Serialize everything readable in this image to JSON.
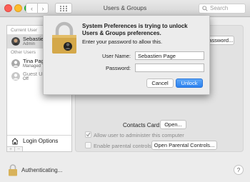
{
  "window": {
    "title": "Users & Groups",
    "search_placeholder": "Search"
  },
  "sidebar": {
    "current_user_label": "Current User",
    "current_user": {
      "name": "Sebastien Page",
      "role": "Admin"
    },
    "other_users_label": "Other Users",
    "other_users": [
      {
        "name": "Tina Page",
        "role": "Managed"
      },
      {
        "name": "Guest User",
        "role": "Off"
      }
    ],
    "login_options_label": "Login Options",
    "add_symbol": "+",
    "remove_symbol": "−"
  },
  "main": {
    "password_button_label": "…assword...",
    "contacts_card_label": "Contacts Card:",
    "open_button_label": "Open...",
    "allow_admin_label": "Allow user to administer this computer",
    "parental_controls_label": "Enable parental controls",
    "open_parental_button_label": "Open Parental Controls..."
  },
  "footer": {
    "authenticating_label": "Authenticating...",
    "help_symbol": "?"
  },
  "dialog": {
    "title": "System Preferences is trying to unlock Users & Groups preferences.",
    "message": "Enter your password to allow this.",
    "username_label": "User Name:",
    "username_value": "Sebastien Page",
    "password_label": "Password:",
    "password_value": "",
    "cancel_label": "Cancel",
    "unlock_label": "Unlock"
  },
  "colors": {
    "accent": "#2b81ef",
    "lock_gold": "#d4a84a",
    "window_bg": "#ececec"
  }
}
